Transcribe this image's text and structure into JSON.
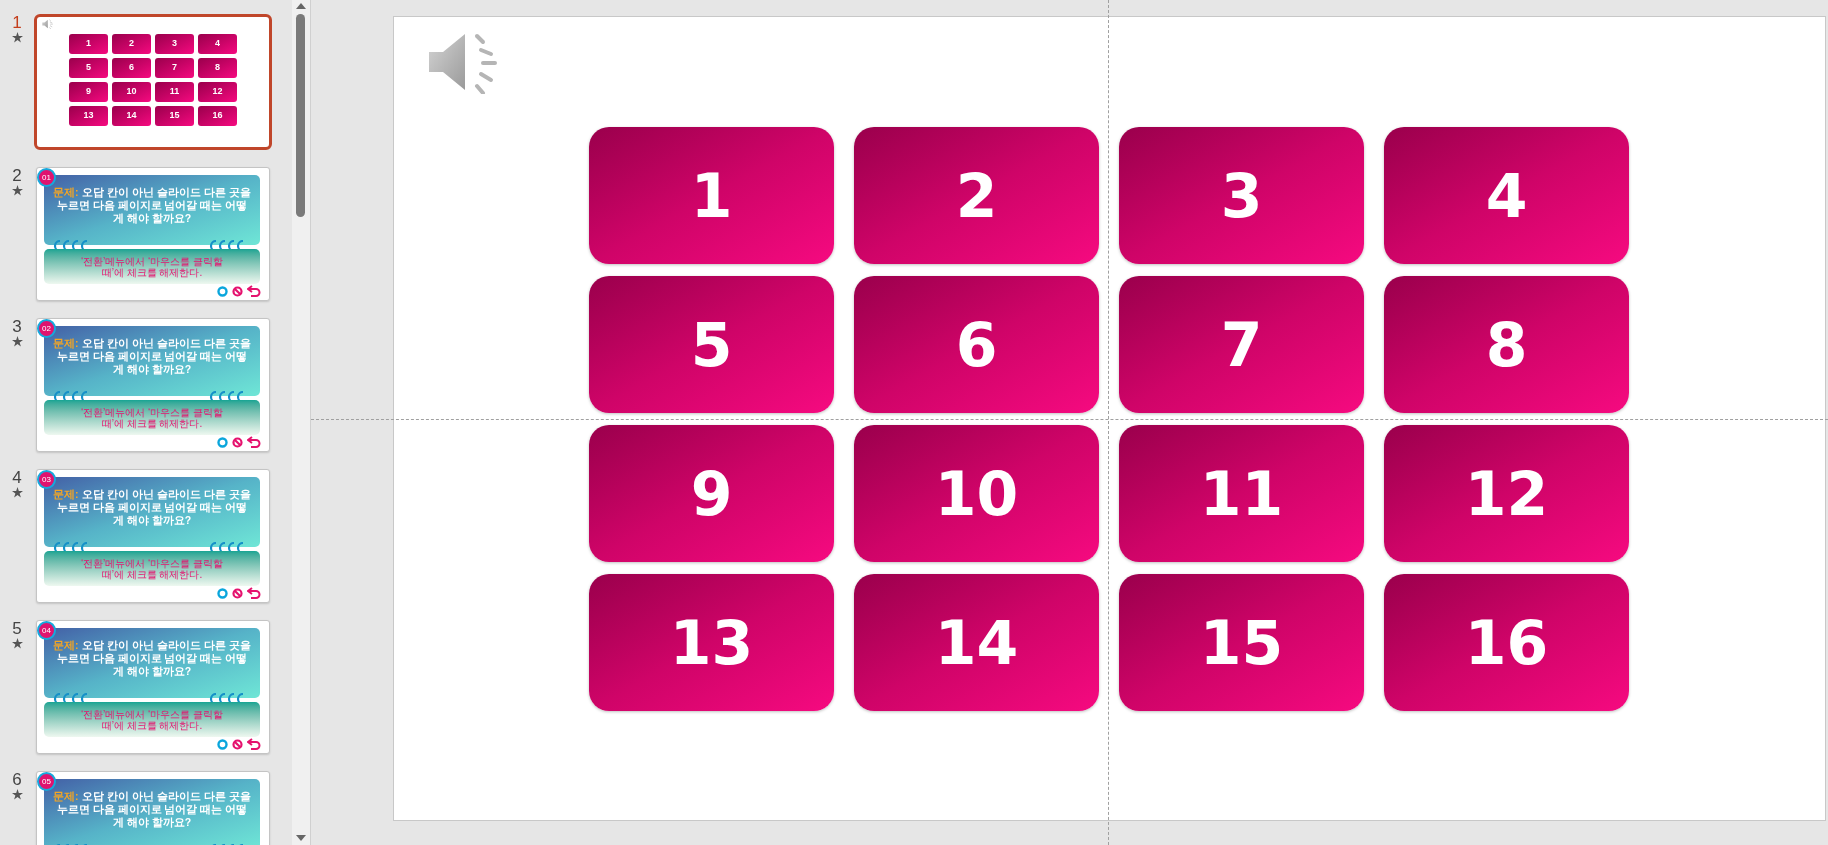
{
  "slides_panel": {
    "thumbnails": [
      {
        "number": "1",
        "selected": true,
        "animated": true,
        "kind": "grid",
        "has_audio": true,
        "tiles": [
          "1",
          "2",
          "3",
          "4",
          "5",
          "6",
          "7",
          "8",
          "9",
          "10",
          "11",
          "12",
          "13",
          "14",
          "15",
          "16"
        ]
      },
      {
        "number": "2",
        "selected": false,
        "animated": true,
        "kind": "quiz",
        "badge": "01",
        "label": "문제:",
        "question": "오답 칸이 아닌 슬라이드 다른 곳을 누르면 다음 페이지로 넘어갈 때는 어떻게 해야 할까요?",
        "answer": "‘전환’메뉴에서 ‘마우스를 클릭할 때’에 체크를 해제한다."
      },
      {
        "number": "3",
        "selected": false,
        "animated": true,
        "kind": "quiz",
        "badge": "02",
        "label": "문제:",
        "question": "오답 칸이 아닌 슬라이드 다른 곳을 누르면 다음 페이지로 넘어갈 때는 어떻게 해야 할까요?",
        "answer": "‘전환’메뉴에서 ‘마우스를 클릭할 때’에 체크를 해제한다."
      },
      {
        "number": "4",
        "selected": false,
        "animated": true,
        "kind": "quiz",
        "badge": "03",
        "label": "문제:",
        "question": "오답 칸이 아닌 슬라이드 다른 곳을 누르면 다음 페이지로 넘어갈 때는 어떻게 해야 할까요?",
        "answer": "‘전환’메뉴에서 ‘마우스를 클릭할 때’에 체크를 해제한다."
      },
      {
        "number": "5",
        "selected": false,
        "animated": true,
        "kind": "quiz",
        "badge": "04",
        "label": "문제:",
        "question": "오답 칸이 아닌 슬라이드 다른 곳을 누르면 다음 페이지로 넘어갈 때는 어떻게 해야 할까요?",
        "answer": "‘전환’메뉴에서 ‘마우스를 클릭할 때’에 체크를 해제한다."
      },
      {
        "number": "6",
        "selected": false,
        "animated": true,
        "kind": "quiz",
        "badge": "05",
        "label": "문제:",
        "question": "오답 칸이 아닌 슬라이드 다른 곳을 누르면 다음 페이지로 넘어갈 때는 어떻게 해야 할까요?"
      }
    ]
  },
  "slide": {
    "has_audio": true,
    "tiles": [
      "1",
      "2",
      "3",
      "4",
      "5",
      "6",
      "7",
      "8",
      "9",
      "10",
      "11",
      "12",
      "13",
      "14",
      "15",
      "16"
    ]
  }
}
